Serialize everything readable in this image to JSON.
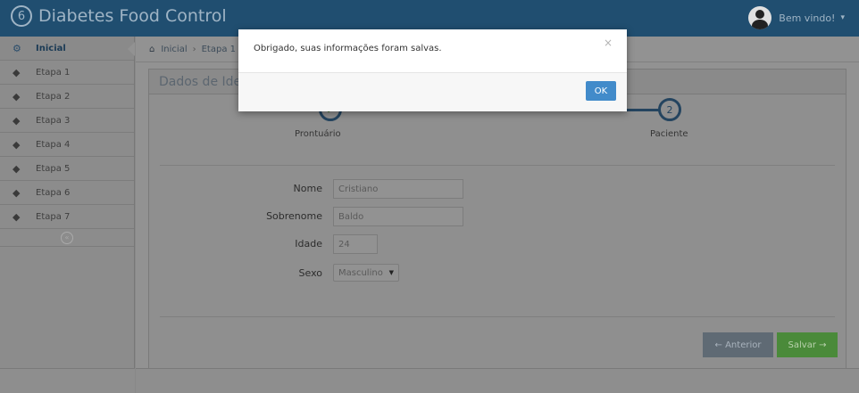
{
  "app": {
    "title": "Diabetes Food Control",
    "logo_glyph": "6"
  },
  "user": {
    "greeting": "Bem vindo!",
    "caret": "▾"
  },
  "sidebar": {
    "items": [
      {
        "label": "Inicial",
        "icon": "dashboard-icon",
        "glyph": "⚙",
        "active": true
      },
      {
        "label": "Etapa 1",
        "icon": "tags-icon",
        "glyph": "◆"
      },
      {
        "label": "Etapa 2",
        "icon": "tags-icon",
        "glyph": "◆"
      },
      {
        "label": "Etapa 3",
        "icon": "tags-icon",
        "glyph": "◆"
      },
      {
        "label": "Etapa 4",
        "icon": "tags-icon",
        "glyph": "◆"
      },
      {
        "label": "Etapa 5",
        "icon": "tags-icon",
        "glyph": "◆"
      },
      {
        "label": "Etapa 6",
        "icon": "tags-icon",
        "glyph": "◆"
      },
      {
        "label": "Etapa 7",
        "icon": "tags-icon",
        "glyph": "◆"
      }
    ],
    "collapse_glyph": "«"
  },
  "breadcrumb": {
    "home_glyph": "⌂",
    "items": [
      "Inicial",
      "Etapa 1"
    ],
    "separator": "›"
  },
  "panel": {
    "title": "Dados de Identificação"
  },
  "wizard": {
    "steps": [
      {
        "label": "Prontuário",
        "marker": "✔",
        "done": true
      },
      {
        "label": "Paciente",
        "marker": "2",
        "done": false
      }
    ]
  },
  "form": {
    "nome": {
      "label": "Nome",
      "value": "Cristiano"
    },
    "sobrenome": {
      "label": "Sobrenome",
      "value": "Baldo"
    },
    "idade": {
      "label": "Idade",
      "value": "24"
    },
    "sexo": {
      "label": "Sexo",
      "value": "Masculino",
      "arrow": "▼"
    }
  },
  "buttons": {
    "prev": "← Anterior",
    "save": "Salvar →"
  },
  "modal": {
    "message": "Obrigado, suas informações foram salvas.",
    "close": "×",
    "ok": "OK"
  },
  "colors": {
    "navbar": "#204e70",
    "ok_button": "#428bca",
    "save_button": "#4a8a3a"
  }
}
